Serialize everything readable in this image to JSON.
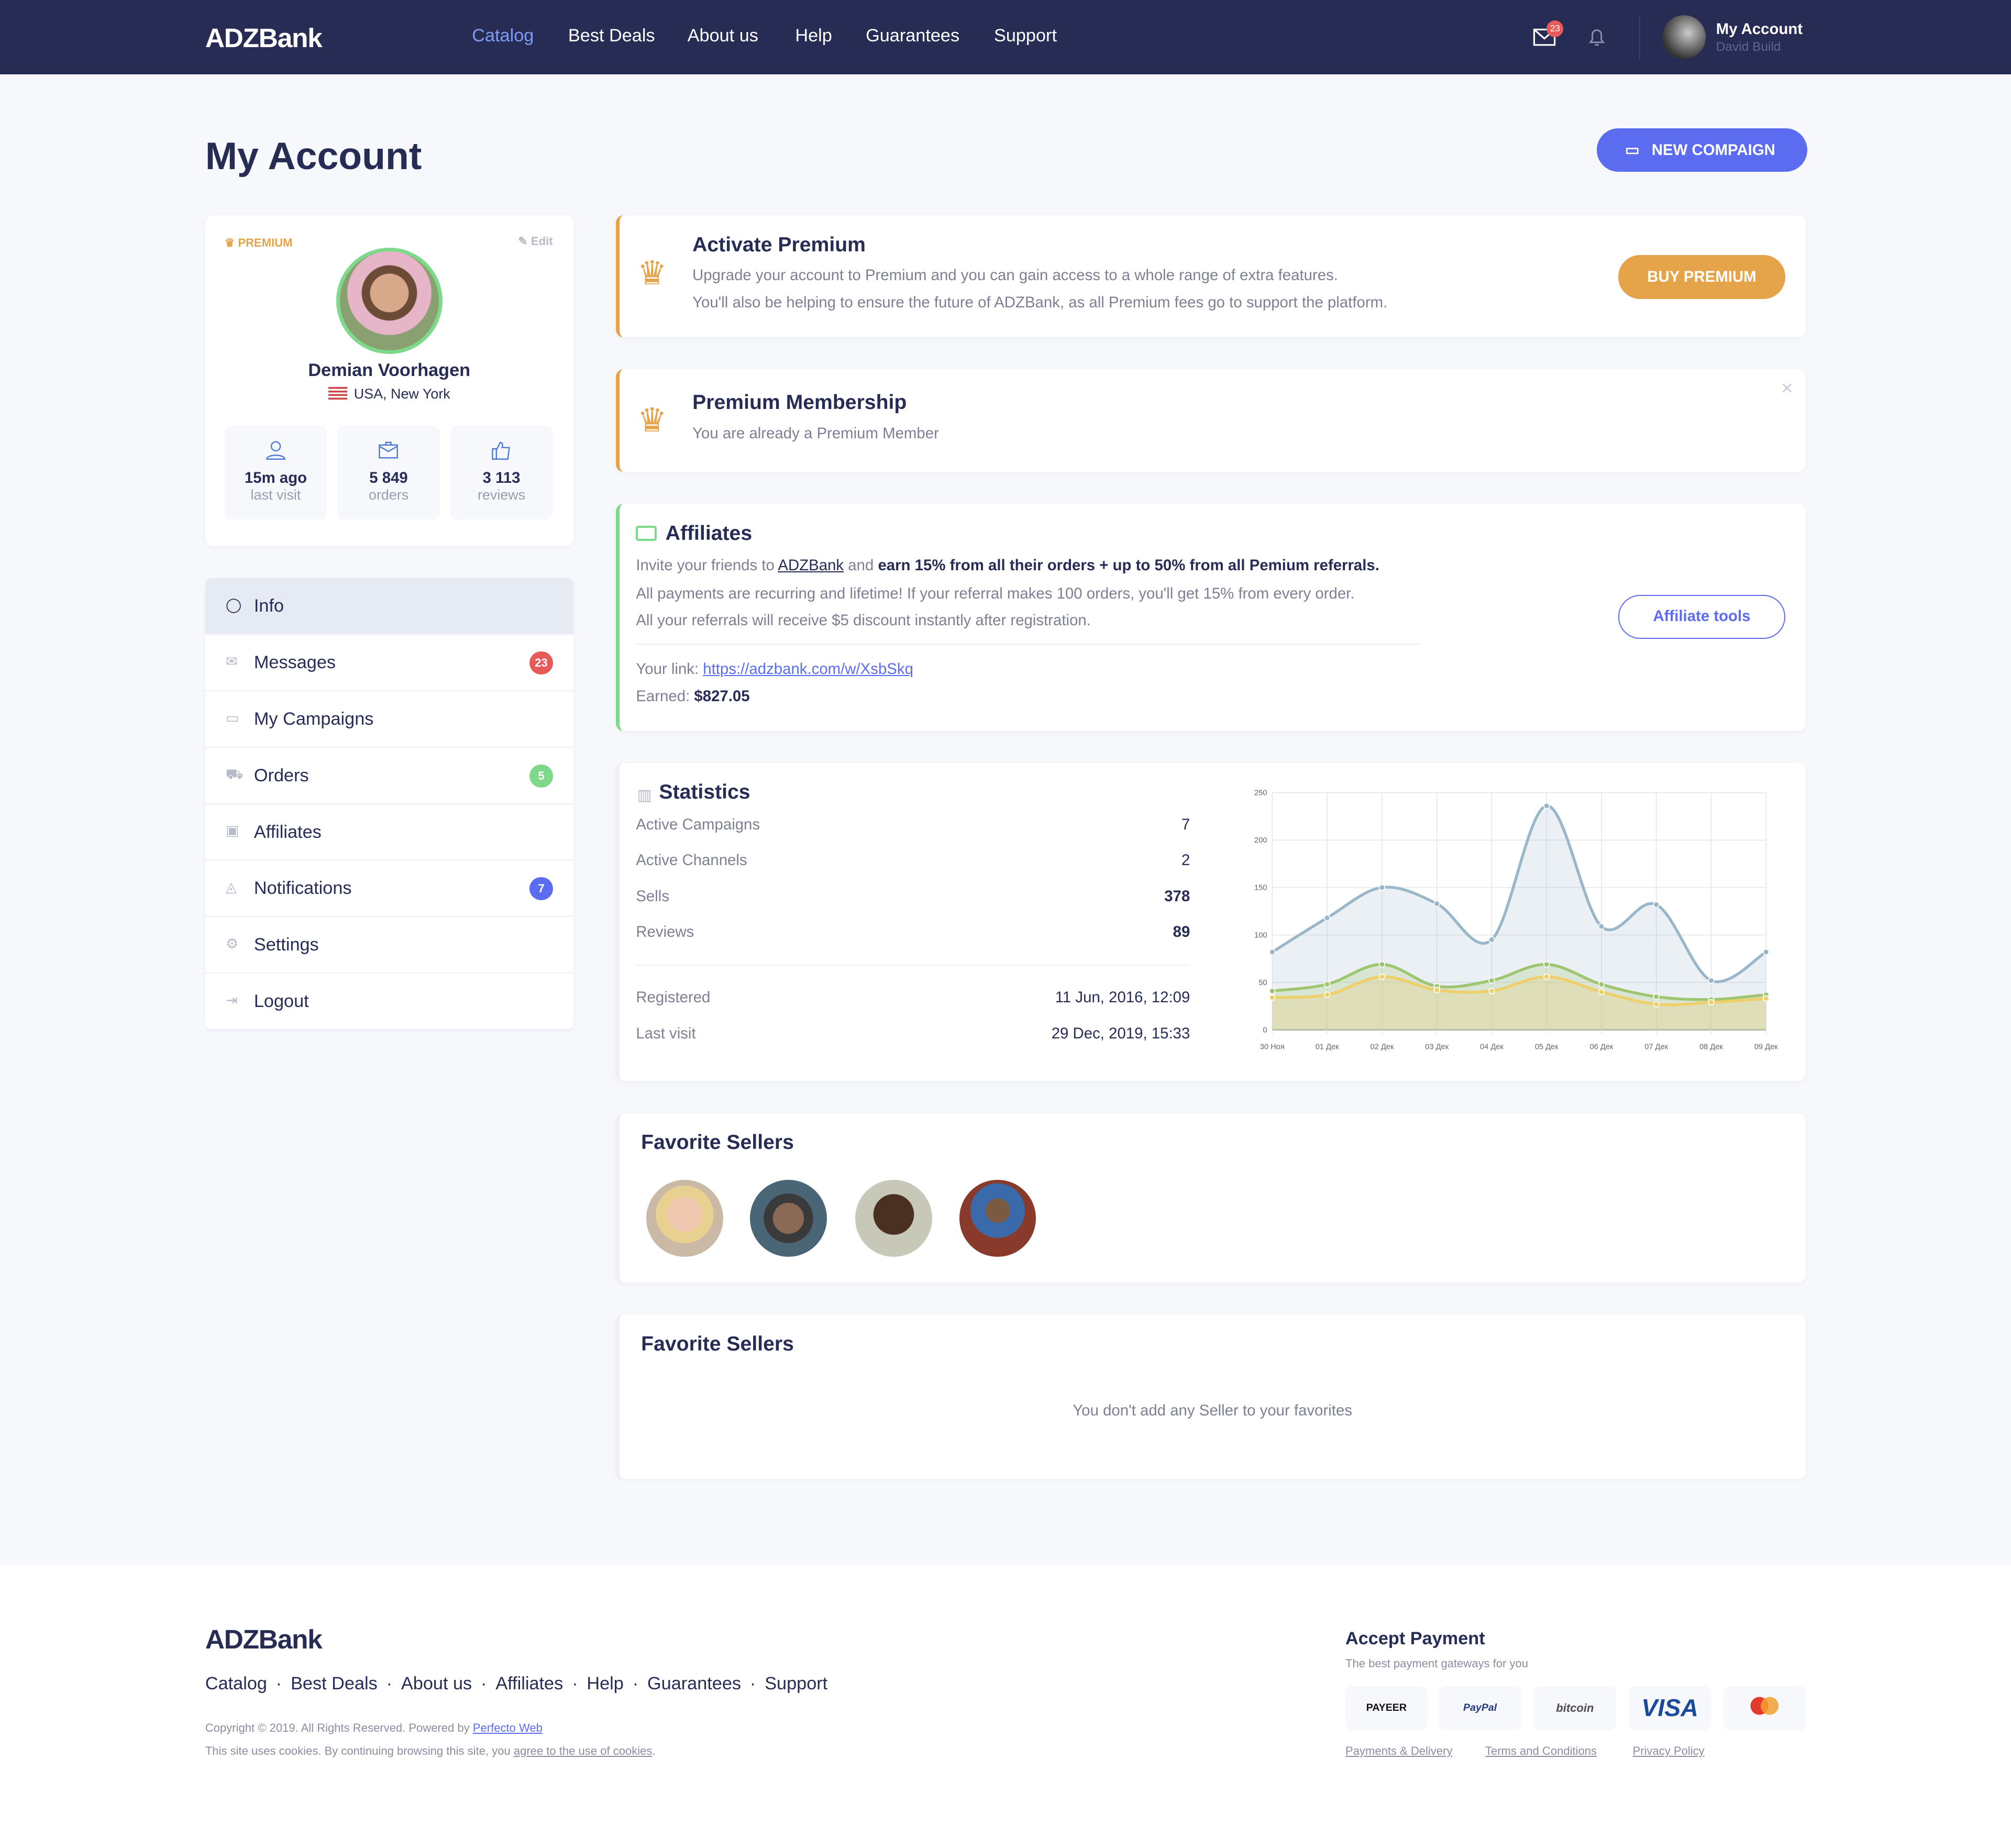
{
  "header": {
    "logo": "ADZBank",
    "nav": [
      "Catalog",
      "Best Deals",
      "About us",
      "Help",
      "Guarantees",
      "Support"
    ],
    "active_nav": "Catalog",
    "messages_badge": "23",
    "account_title": "My Account",
    "account_user": "David Build"
  },
  "page": {
    "title": "My Account",
    "new_button": "NEW COMPAIGN"
  },
  "profile": {
    "badge": "PREMIUM",
    "edit": "Edit",
    "name": "Demian Voorhagen",
    "location": "USA, New York",
    "stats": [
      {
        "value": "15m ago",
        "label": "last visit"
      },
      {
        "value": "5 849",
        "label": "orders"
      },
      {
        "value": "3 113",
        "label": "reviews"
      }
    ]
  },
  "menu": [
    {
      "label": "Info",
      "icon": "user-icon",
      "active": true
    },
    {
      "label": "Messages",
      "icon": "envelope-icon",
      "badge": "23",
      "badge_color": "#e85a5a"
    },
    {
      "label": "My Campaigns",
      "icon": "briefcase-icon"
    },
    {
      "label": "Orders",
      "icon": "cart-icon",
      "badge": "5",
      "badge_color": "#7ed98b"
    },
    {
      "label": "Affiliates",
      "icon": "money-icon"
    },
    {
      "label": "Notifications",
      "icon": "bell-icon",
      "badge": "7",
      "badge_color": "#5b6cf0"
    },
    {
      "label": "Settings",
      "icon": "gear-icon"
    },
    {
      "label": "Logout",
      "icon": "logout-icon"
    }
  ],
  "activate": {
    "title": "Activate Premium",
    "line1": "Upgrade your account to Premium and you can gain access to a whole range of extra features.",
    "line2": "You'll also be helping to ensure the future of ADZBank, as all Premium fees go to support the platform.",
    "button": "BUY PREMIUM"
  },
  "membership": {
    "title": "Premium Membership",
    "text": "You are already a Premium Member"
  },
  "affiliates": {
    "title": "Affiliates",
    "intro_a": "Invite your friends to ",
    "intro_link": "ADZBank",
    "intro_b": " and ",
    "intro_bold": "earn 15% from all their orders + up to 50% from all Pemium referrals.",
    "line2": "All payments are recurring and lifetime! If your referral makes 100 orders, you'll get 15% from every order.",
    "line3": "All your referrals will receive $5 discount instantly after registration.",
    "link_label": "Your link: ",
    "link": "https://adzbank.com/w/XsbSkq",
    "earned_label": "Earned: ",
    "earned": "$827.05",
    "button": "Affiliate tools"
  },
  "statistics": {
    "title": "Statistics",
    "rows": [
      {
        "label": "Active Campaigns",
        "value": "7"
      },
      {
        "label": "Active Channels",
        "value": "2"
      },
      {
        "label": "Sells",
        "value": "378"
      },
      {
        "label": "Reviews",
        "value": "89"
      }
    ],
    "registered_label": "Registered",
    "registered": "11 Jun, 2016, 12:09",
    "last_visit_label": "Last visit",
    "last_visit": "29 Dec, 2019, 15:33"
  },
  "chart_data": {
    "type": "area",
    "categories": [
      "30 Ноя",
      "01 Дек",
      "02 Дек",
      "03 Дек",
      "04 Дек",
      "05 Дек",
      "06 Дек",
      "07 Дек",
      "08 Дек",
      "09 Дек"
    ],
    "ylim": [
      0,
      250
    ],
    "yticks": [
      0,
      50,
      100,
      150,
      200,
      250
    ],
    "grid": true,
    "series": [
      {
        "values": [
          82,
          118,
          150,
          133,
          95,
          236,
          109,
          132,
          52,
          82
        ],
        "color": "#9ab6c9"
      },
      {
        "values": [
          41,
          48,
          69,
          46,
          52,
          69,
          48,
          35,
          32,
          37
        ],
        "color": "#9ec56f"
      },
      {
        "values": [
          34,
          37,
          56,
          42,
          41,
          56,
          40,
          27,
          29,
          33
        ],
        "color": "#efcf6a"
      }
    ]
  },
  "favorites": {
    "title": "Favorite Sellers",
    "title2": "Favorite Sellers",
    "empty": "You don't add any Seller to your favorites"
  },
  "footer": {
    "logo": "ADZBank",
    "links": [
      "Catalog",
      "Best Deals",
      "About us",
      "Affiliates",
      "Help",
      "Guarantees",
      "Support"
    ],
    "copyright": "Copyright © 2019. All Rights Reserved. Powered by ",
    "powered": "Perfecto Web",
    "cookies": "This site uses cookies. By continuing browsing this site, you ",
    "cookies_link": "agree to the use of cookies",
    "payment_title": "Accept Payment",
    "payment_sub": "The best payment gateways for you",
    "payments": [
      "PAYEER",
      "PayPal",
      "bitcoin",
      "VISA",
      "mastercard"
    ],
    "bottom_links": [
      "Payments & Delivery",
      "Terms and Conditions",
      "Privacy Policy"
    ]
  }
}
